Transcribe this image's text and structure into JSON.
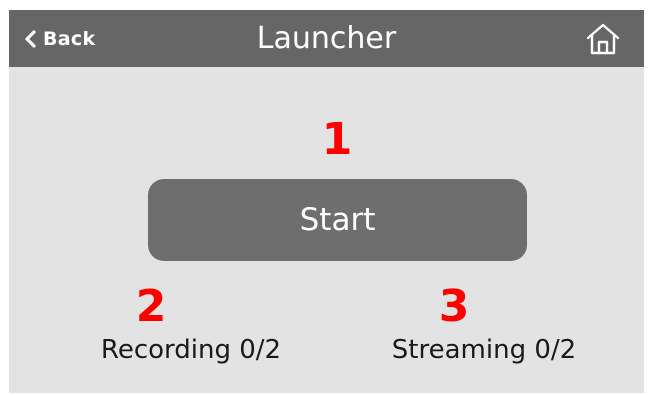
{
  "header": {
    "back_label": "Back",
    "title": "Launcher",
    "home_icon": "home-icon",
    "back_icon": "chevron-left-icon"
  },
  "callouts": {
    "one": "1",
    "two": "2",
    "three": "3"
  },
  "main": {
    "start_label": "Start",
    "recording_status": "Recording 0/2",
    "streaming_status": "Streaming 0/2"
  },
  "colors": {
    "header_bg": "#666666",
    "screen_bg": "#e3e3e3",
    "button_bg": "#6e6e6e",
    "callout": "#ff0000"
  }
}
